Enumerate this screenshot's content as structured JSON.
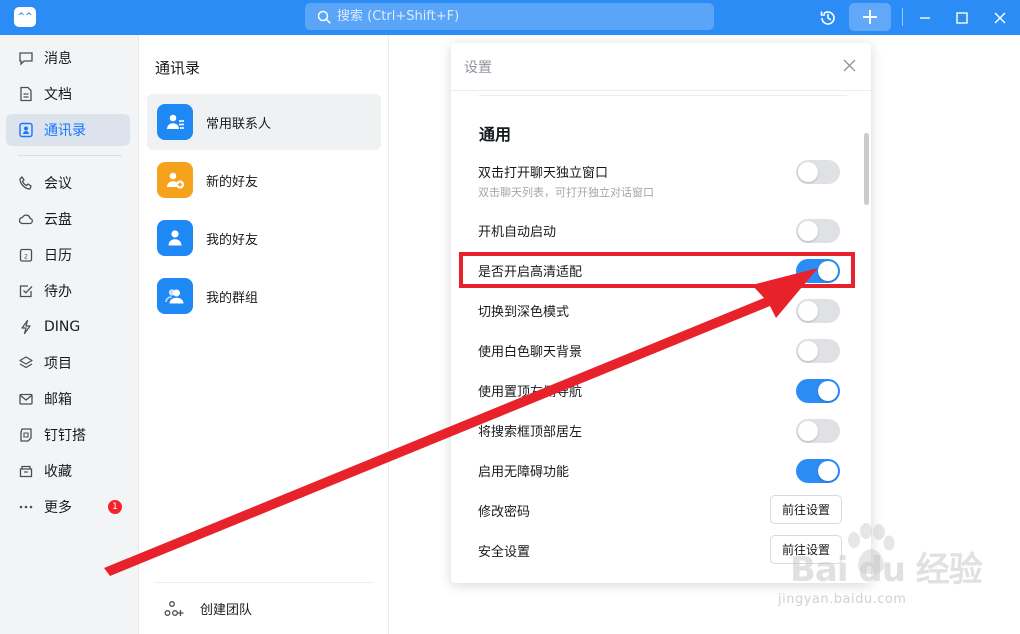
{
  "titlebar": {
    "logo_text": "^^",
    "search_placeholder": "搜索 (Ctrl+Shift+F)",
    "accent": "#2c8cf6"
  },
  "nav": {
    "items": [
      {
        "label": "消息",
        "icon": "message-icon"
      },
      {
        "label": "文档",
        "icon": "document-icon"
      },
      {
        "label": "通讯录",
        "icon": "contacts-icon",
        "active": true
      },
      {
        "label": "会议",
        "icon": "phone-icon"
      },
      {
        "label": "云盘",
        "icon": "cloud-icon"
      },
      {
        "label": "日历",
        "icon": "calendar-icon"
      },
      {
        "label": "待办",
        "icon": "todo-icon"
      },
      {
        "label": "DING",
        "icon": "lightning-icon"
      },
      {
        "label": "项目",
        "icon": "layers-icon"
      },
      {
        "label": "邮箱",
        "icon": "mail-icon"
      },
      {
        "label": "钉钉搭",
        "icon": "builder-icon"
      },
      {
        "label": "收藏",
        "icon": "collection-icon"
      },
      {
        "label": "更多",
        "icon": "more-icon",
        "badge": "1"
      }
    ]
  },
  "contacts": {
    "title": "通讯录",
    "items": [
      {
        "label": "常用联系人",
        "color": "#1e88f5"
      },
      {
        "label": "新的好友",
        "color": "#f7a21d"
      },
      {
        "label": "我的好友",
        "color": "#1e88f5"
      },
      {
        "label": "我的群组",
        "color": "#1e88f5"
      }
    ],
    "create_team": "创建团队"
  },
  "settings": {
    "title": "设置",
    "section": "通用",
    "rows": [
      {
        "label": "双击打开聊天独立窗口",
        "desc": "双击聊天列表，可打开独立对话窗口",
        "type": "toggle",
        "on": false
      },
      {
        "label": "开机自动启动",
        "type": "toggle",
        "on": false
      },
      {
        "label": "是否开启高清适配",
        "type": "toggle",
        "on": true
      },
      {
        "label": "切换到深色模式",
        "type": "toggle",
        "on": false
      },
      {
        "label": "使用白色聊天背景",
        "type": "toggle",
        "on": false
      },
      {
        "label": "使用置顶左侧导航",
        "type": "toggle",
        "on": true
      },
      {
        "label": "将搜索框顶部居左",
        "type": "toggle",
        "on": false
      },
      {
        "label": "启用无障碍功能",
        "type": "toggle",
        "on": true
      },
      {
        "label": "修改密码",
        "type": "button",
        "button": "前往设置"
      },
      {
        "label": "安全设置",
        "type": "button",
        "button": "前往设置"
      }
    ]
  },
  "watermark": {
    "main": "Bai du 经验",
    "sub": "jingyan.baidu.com"
  },
  "annotation_color": "#e8222b"
}
